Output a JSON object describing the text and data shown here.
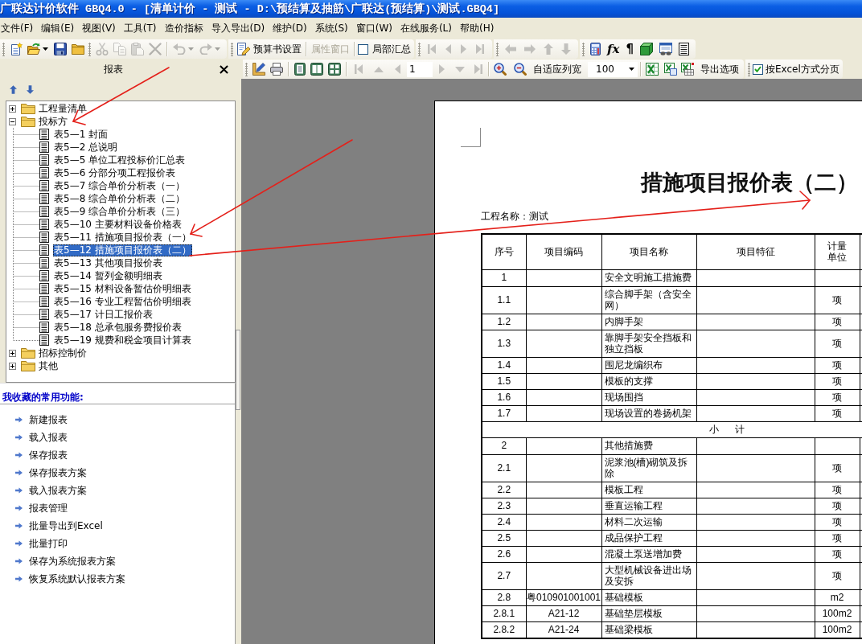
{
  "window": {
    "title": "广联达计价软件 GBQ4.0 - [清单计价 - 测试 - D:\\预结算及抽筋\\广联达(预结算)\\测试.GBQ4]"
  },
  "menu": [
    "文件(F)",
    "编辑(E)",
    "视图(V)",
    "工具(T)",
    "造价指标",
    "导入导出(D)",
    "维护(D)",
    "系统(S)",
    "窗口(W)",
    "在线服务(L)",
    "帮助(H)"
  ],
  "main_toolbar": {
    "file_buttons": [
      {
        "disabled": false
      },
      {
        "disabled": false
      },
      {
        "disabled": false
      },
      {
        "disabled": false
      }
    ],
    "edit_buttons": [
      {
        "disabled": true
      },
      {
        "disabled": true
      },
      {
        "disabled": true
      },
      {
        "disabled": true
      }
    ],
    "history_buttons": [
      {
        "disabled": true
      },
      {
        "disabled": true
      }
    ],
    "text_buttons": [
      {
        "label": "预算书设置",
        "disabled": false
      },
      {
        "label": "属性窗口",
        "disabled": true
      }
    ],
    "partial_summary": {
      "label": "局部汇总",
      "checked": false
    },
    "record_nav": [
      {
        "disabled": true
      },
      {
        "disabled": true
      },
      {
        "disabled": true
      },
      {
        "disabled": true
      }
    ],
    "move_buttons": [
      {
        "disabled": true
      },
      {
        "disabled": true
      },
      {
        "disabled": true
      },
      {
        "disabled": true
      }
    ],
    "tool_buttons": [
      {
        "kind": "icon",
        "disabled": false
      },
      {
        "kind": "glyph",
        "glyph": "fx",
        "disabled": false
      },
      {
        "kind": "glyph",
        "glyph": "¶",
        "disabled": false
      },
      {
        "kind": "icon",
        "disabled": false
      },
      {
        "kind": "icon",
        "disabled": false
      },
      {
        "kind": "icon",
        "disabled": false
      }
    ]
  },
  "report_panel": {
    "title": "报表"
  },
  "tree": [
    {
      "label": "工程量清单",
      "expanded": false,
      "selected": false
    },
    {
      "label": "投标方",
      "expanded": true,
      "selected": false,
      "children": [
        {
          "label": "表5—1 封面",
          "selected": false
        },
        {
          "label": "表5—2 总说明",
          "selected": false
        },
        {
          "label": "表5—5 单位工程投标价汇总表",
          "selected": false
        },
        {
          "label": "表5—6 分部分项工程报价表",
          "selected": false
        },
        {
          "label": "表5—7 综合单价分析表（一）",
          "selected": false
        },
        {
          "label": "表5—8 综合单价分析表（二）",
          "selected": false
        },
        {
          "label": "表5—9 综合单价分析表（三）",
          "selected": false
        },
        {
          "label": "表5—10 主要材料设备价格表",
          "selected": false
        },
        {
          "label": "表5—11 措施项目报价表（一）",
          "selected": false
        },
        {
          "label": "表5—12 措施项目报价表（二）",
          "selected": true
        },
        {
          "label": "表5—13 其他项目报价表",
          "selected": false
        },
        {
          "label": "表5—14 暂列金额明细表",
          "selected": false
        },
        {
          "label": "表5—15 材料设备暂估价明细表",
          "selected": false
        },
        {
          "label": "表5—16 专业工程暂估价明细表",
          "selected": false
        },
        {
          "label": "表5—17 计日工报价表",
          "selected": false
        },
        {
          "label": "表5—18 总承包服务费报价表",
          "selected": false
        },
        {
          "label": "表5—19 规费和税金项目计算表",
          "selected": false
        }
      ]
    },
    {
      "label": "招标控制价",
      "expanded": false,
      "selected": false
    },
    {
      "label": "其他",
      "expanded": false,
      "selected": false
    }
  ],
  "favorites": {
    "title": "我收藏的常用功能:",
    "items": [
      "新建报表",
      "载入报表",
      "保存报表",
      "保存报表方案",
      "载入报表方案",
      "报表管理",
      "批量导出到Excel",
      "批量打印",
      "保存为系统报表方案",
      "恢复系统默认报表方案"
    ]
  },
  "report_toolbar": {
    "view_buttons": [
      {
        "disabled": false
      },
      {
        "disabled": false
      },
      {
        "disabled": false
      },
      {
        "disabled": false
      },
      {
        "disabled": false
      }
    ],
    "nav_back": [
      {
        "disabled": true
      },
      {
        "disabled": true
      },
      {
        "disabled": true
      }
    ],
    "page": "1",
    "nav_forward": [
      {
        "disabled": true
      },
      {
        "disabled": true
      },
      {
        "disabled": true
      }
    ],
    "zoom_buttons": [
      {
        "disabled": false
      },
      {
        "disabled": false
      }
    ],
    "fit_width": "自适应列宽",
    "zoom": "100",
    "export_buttons": [
      {
        "disabled": false
      },
      {
        "disabled": false
      },
      {
        "disabled": false
      }
    ],
    "export_options": "导出选项",
    "excel_paging": {
      "label": "按Excel方式分页",
      "checked": true
    }
  },
  "document": {
    "title": "措施项目报价表（二）",
    "project": "工程名称：测试",
    "table": {
      "columns": [
        "序号",
        "项目编码",
        "项目名称",
        "项目特征",
        "计量单位"
      ],
      "rows": [
        {
          "kind": "group",
          "no": "1",
          "name": "安全文明施工措施费"
        },
        {
          "kind": "item",
          "no": "1.1",
          "name": "综合脚手架（含安全网）",
          "unit": "项"
        },
        {
          "kind": "item",
          "no": "1.2",
          "name": "内脚手架",
          "unit": "项"
        },
        {
          "kind": "item",
          "no": "1.3",
          "name": "靠脚手架安全挡板和独立挡板",
          "unit": "项"
        },
        {
          "kind": "item",
          "no": "1.4",
          "name": "围尼龙编织布",
          "unit": "项"
        },
        {
          "kind": "item",
          "no": "1.5",
          "name": "模板的支撑",
          "unit": "项"
        },
        {
          "kind": "item",
          "no": "1.6",
          "name": "现场围挡",
          "unit": "项"
        },
        {
          "kind": "item",
          "no": "1.7",
          "name": "现场设置的卷扬机架",
          "unit": "项"
        },
        {
          "kind": "subtotal",
          "label": "小      计"
        },
        {
          "kind": "group",
          "no": "2",
          "name": "其他措施费"
        },
        {
          "kind": "item",
          "no": "2.1",
          "name": "泥浆池(槽)砌筑及拆除",
          "unit": "项"
        },
        {
          "kind": "item",
          "no": "2.2",
          "name": "模板工程",
          "unit": "项"
        },
        {
          "kind": "item",
          "no": "2.3",
          "name": "垂直运输工程",
          "unit": "项"
        },
        {
          "kind": "item",
          "no": "2.4",
          "name": "材料二次运输",
          "unit": "项"
        },
        {
          "kind": "item",
          "no": "2.5",
          "name": "成品保护工程",
          "unit": "项"
        },
        {
          "kind": "item",
          "no": "2.6",
          "name": "混凝土泵送增加费",
          "unit": "项"
        },
        {
          "kind": "item",
          "no": "2.7",
          "name": "大型机械设备进出场及安拆",
          "unit": "项"
        },
        {
          "kind": "item",
          "no": "2.8",
          "code": "粤010901001001",
          "name": "基础模板",
          "unit": "m2"
        },
        {
          "kind": "item",
          "no": "2.8.1",
          "code": "A21-12",
          "name": "基础垫层模板",
          "unit": "100m2"
        },
        {
          "kind": "item",
          "no": "2.8.2",
          "code": "A21-24",
          "name": "基础梁模板",
          "unit": "100m2"
        }
      ]
    }
  }
}
